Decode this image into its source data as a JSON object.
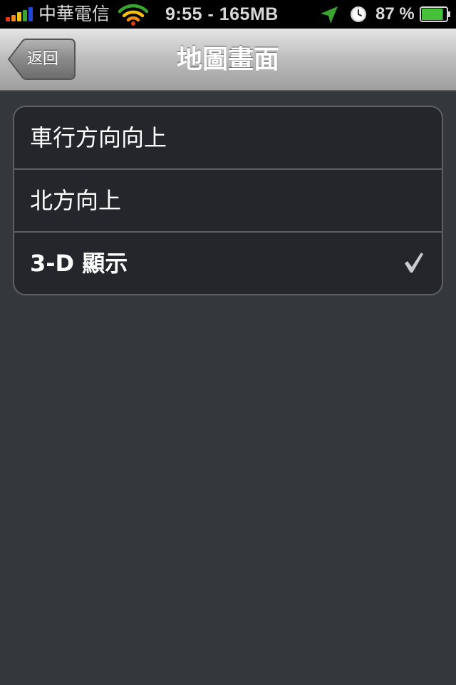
{
  "status_bar": {
    "carrier": "中華電信",
    "time_memory": "9:55 - 165MB",
    "battery_percent": "87 %",
    "battery_level": 0.87,
    "icons": [
      "signal-bars-icon",
      "wifi-icon",
      "location-arrow-icon",
      "clock-icon",
      "battery-icon"
    ],
    "signal_colors": [
      "#e23a17",
      "#f08a14",
      "#f4c010",
      "#3aa430",
      "#2046d8"
    ]
  },
  "nav": {
    "back_label": "返回",
    "title": "地圖畫面"
  },
  "options": [
    {
      "label": "車行方向向上",
      "selected": false
    },
    {
      "label": "北方向上",
      "selected": false
    },
    {
      "label": "3-D 顯示",
      "selected": true
    }
  ],
  "colors": {
    "background": "#34373c",
    "list_background": "#24262b",
    "separator": "#5c5f66"
  }
}
